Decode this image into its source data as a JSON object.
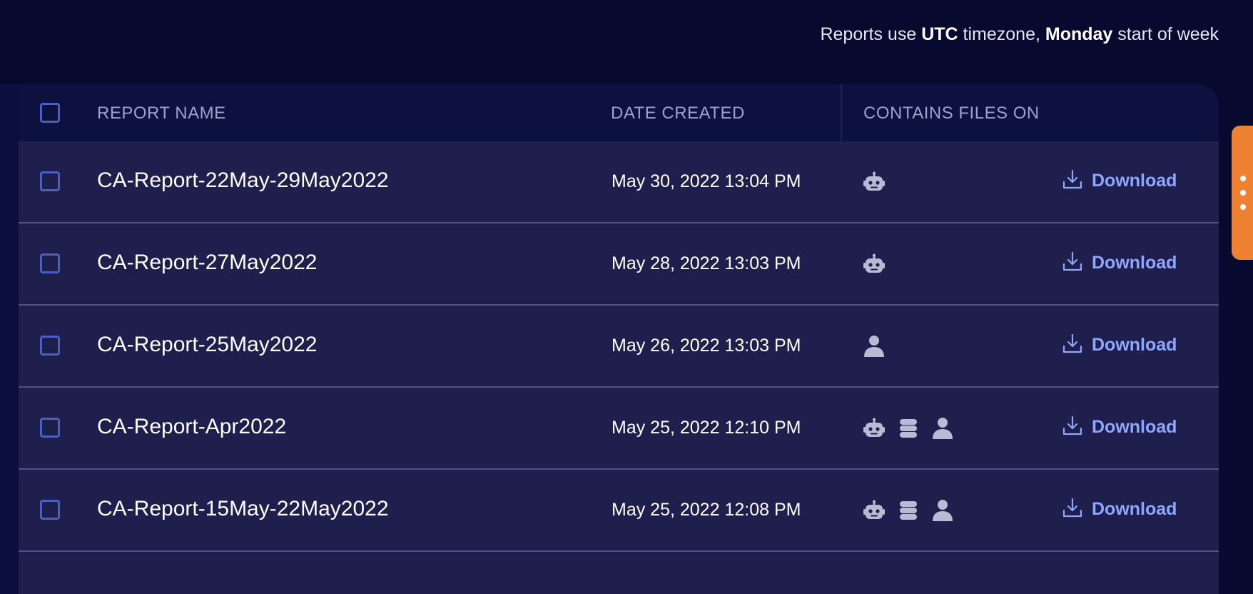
{
  "header": {
    "tz_prefix": "Reports use ",
    "tz_value": "UTC",
    "tz_middle": " timezone, ",
    "week_value": "Monday",
    "tz_suffix": " start of week"
  },
  "table": {
    "columns": {
      "name": "REPORT NAME",
      "date": "DATE CREATED",
      "files": "CONTAINS FILES ON"
    },
    "download_label": "Download",
    "rows": [
      {
        "name": "CA-Report-22May-29May2022",
        "date": "May 30, 2022 13:04 PM",
        "files": [
          "robot-icon"
        ]
      },
      {
        "name": "CA-Report-27May2022",
        "date": "May 28, 2022 13:03 PM",
        "files": [
          "robot-icon"
        ]
      },
      {
        "name": "CA-Report-25May2022",
        "date": "May 26, 2022 13:03 PM",
        "files": [
          "user-icon"
        ]
      },
      {
        "name": "CA-Report-Apr2022",
        "date": "May 25, 2022 12:10 PM",
        "files": [
          "robot-icon",
          "database-icon",
          "user-icon"
        ]
      },
      {
        "name": "CA-Report-15May-22May2022",
        "date": "May 25, 2022 12:08 PM",
        "files": [
          "robot-icon",
          "database-icon",
          "user-icon"
        ]
      }
    ]
  },
  "colors": {
    "page_background": "#07092e",
    "table_background": "#1e1f4c",
    "header_background": "#0c1140",
    "accent_link": "#8fa6ff",
    "checkbox_border": "#4a5fc0",
    "side_tab": "#ef8133"
  },
  "side_tab": {
    "icon": "more-vertical-icon"
  }
}
